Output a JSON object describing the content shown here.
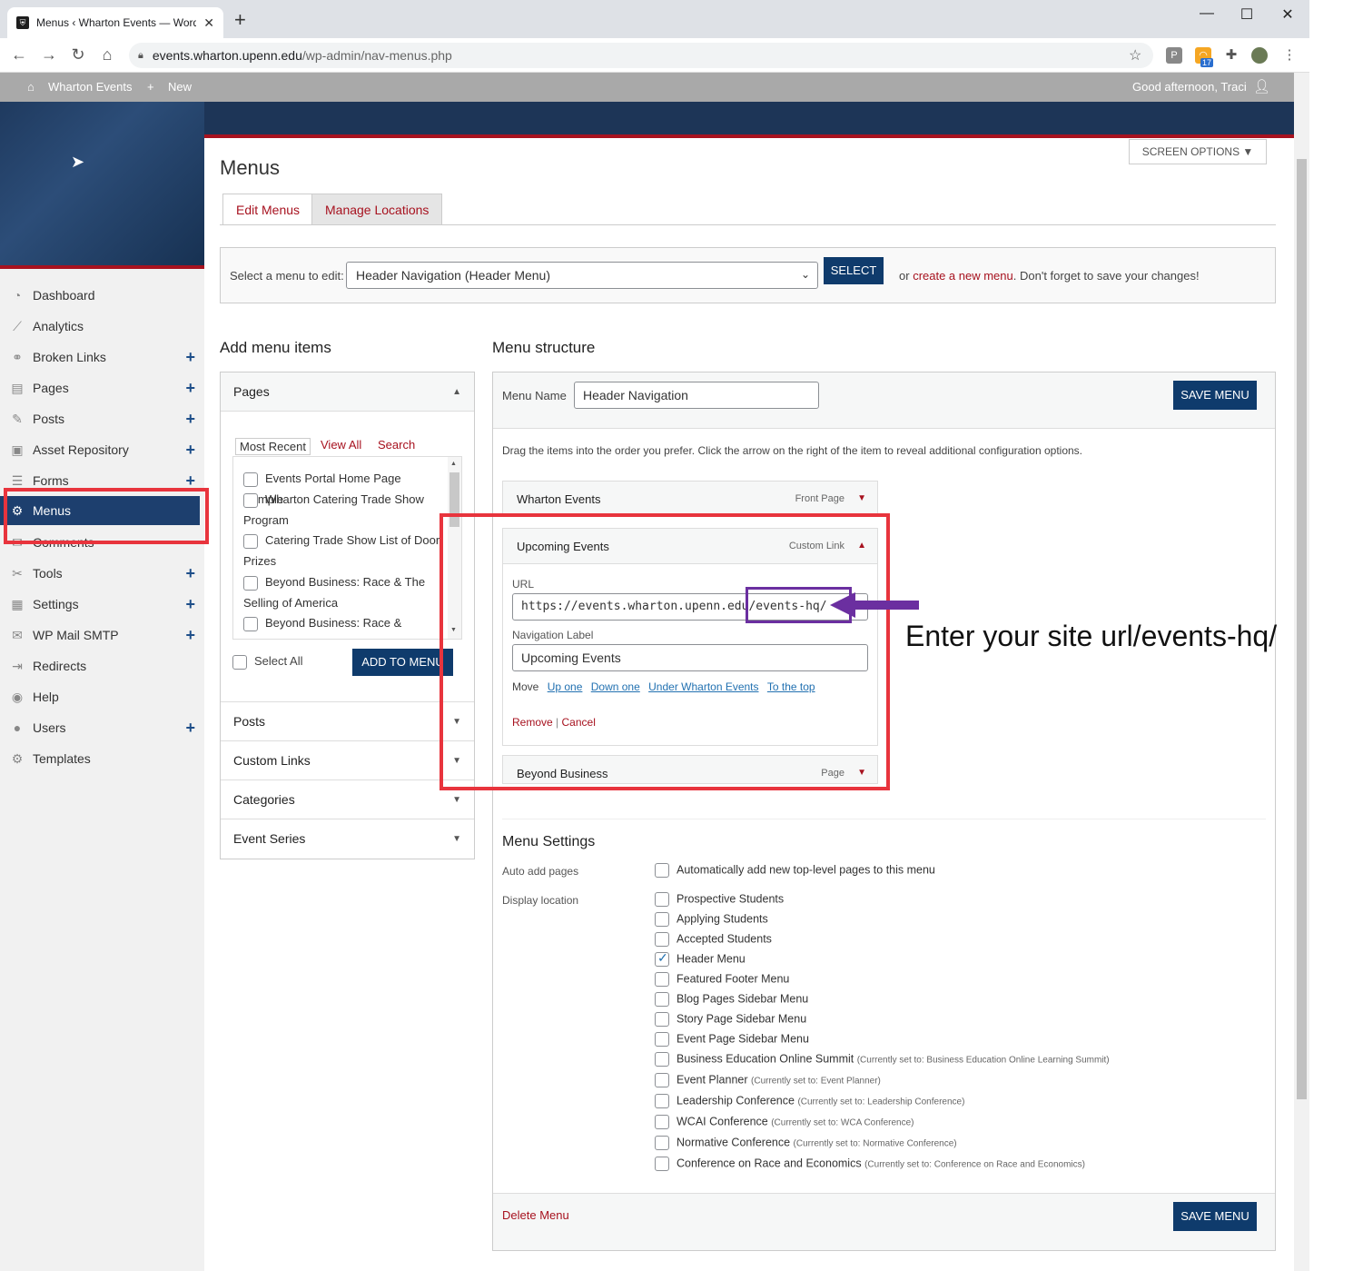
{
  "browser": {
    "tab_title": "Menus ‹ Wharton Events — Word",
    "url_host": "events.wharton.upenn.edu",
    "url_path": "/wp-admin/nav-menus.php",
    "rss_badge": "17"
  },
  "adminbar": {
    "site": "Wharton Events",
    "new": "New",
    "greeting": "Good afternoon, Traci"
  },
  "sidebar": {
    "items": [
      {
        "label": "Dashboard",
        "icon": "dashboard-icon",
        "plus": false
      },
      {
        "label": "Analytics",
        "icon": "analytics-icon",
        "plus": false
      },
      {
        "label": "Broken Links",
        "icon": "broken-link-icon",
        "plus": true
      },
      {
        "label": "Pages",
        "icon": "pages-icon",
        "plus": true
      },
      {
        "label": "Posts",
        "icon": "pin-icon",
        "plus": true
      },
      {
        "label": "Asset Repository",
        "icon": "asset-icon",
        "plus": true
      },
      {
        "label": "Forms",
        "icon": "forms-icon",
        "plus": true
      },
      {
        "label": "Menus",
        "icon": "gear-icon",
        "plus": false,
        "active": true
      },
      {
        "label": "Comments",
        "icon": "comments-icon",
        "plus": false
      },
      {
        "label": "Tools",
        "icon": "wrench-icon",
        "plus": true
      },
      {
        "label": "Settings",
        "icon": "settings-icon",
        "plus": true
      },
      {
        "label": "WP Mail SMTP",
        "icon": "mail-icon",
        "plus": true
      },
      {
        "label": "Redirects",
        "icon": "redirect-icon",
        "plus": false
      },
      {
        "label": "Help",
        "icon": "help-icon",
        "plus": false
      },
      {
        "label": "Users",
        "icon": "users-icon",
        "plus": true
      },
      {
        "label": "Templates",
        "icon": "templates-icon",
        "plus": false
      }
    ]
  },
  "page": {
    "title": "Menus",
    "screen_options": "SCREEN OPTIONS ▼",
    "tabs": [
      "Edit Menus",
      "Manage Locations"
    ],
    "select_label": "Select a menu to edit:",
    "select_value": "Header Navigation (Header Menu)",
    "select_button": "SELECT",
    "or_text": "or",
    "create_link": "create a new menu",
    "save_hint": ". Don't forget to save your changes!"
  },
  "add_items": {
    "heading": "Add menu items",
    "pages_title": "Pages",
    "subtabs": [
      "Most Recent",
      "View All",
      "Search"
    ],
    "pages": [
      "Events Portal Home Page Sample",
      "Wharton Catering Trade Show Program",
      "Catering Trade Show List of Door Prizes",
      "Beyond Business: Race & The Selling of America",
      "Beyond Business: Race &"
    ],
    "select_all": "Select All",
    "add_button": "ADD TO MENU",
    "sections": [
      "Posts",
      "Custom Links",
      "Categories",
      "Event Series"
    ]
  },
  "structure": {
    "heading": "Menu structure",
    "name_label": "Menu Name",
    "name_value": "Header Navigation",
    "save_button": "SAVE MENU",
    "instructions": "Drag the items into the order you prefer. Click the arrow on the right of the item to reveal additional configuration options.",
    "items": [
      {
        "title": "Wharton Events",
        "kind": "Front Page"
      },
      {
        "title": "Upcoming Events",
        "kind": "Custom Link"
      },
      {
        "title": "Beyond Business",
        "kind": "Page"
      }
    ],
    "url_label": "URL",
    "url_value": "https://events.wharton.upenn.edu/events-hq/",
    "nav_label": "Navigation Label",
    "nav_value": "Upcoming Events",
    "move_label": "Move",
    "move_links": [
      "Up one",
      "Down one",
      "Under Wharton Events",
      "To the top"
    ],
    "remove": "Remove",
    "cancel": "Cancel"
  },
  "settings": {
    "heading": "Menu Settings",
    "auto_label": "Auto add pages",
    "auto_option": "Automatically add new top-level pages to this menu",
    "display_label": "Display location",
    "locations": [
      {
        "name": "Prospective Students",
        "current": "",
        "checked": false
      },
      {
        "name": "Applying Students",
        "current": "",
        "checked": false
      },
      {
        "name": "Accepted Students",
        "current": "",
        "checked": false
      },
      {
        "name": "Header Menu",
        "current": "",
        "checked": true
      },
      {
        "name": "Featured Footer Menu",
        "current": "",
        "checked": false
      },
      {
        "name": "Blog Pages Sidebar Menu",
        "current": "",
        "checked": false
      },
      {
        "name": "Story Page Sidebar Menu",
        "current": "",
        "checked": false
      },
      {
        "name": "Event Page Sidebar Menu",
        "current": "",
        "checked": false
      },
      {
        "name": "Business Education Online Summit",
        "current": "(Currently set to: Business Education Online Learning Summit)",
        "checked": false
      },
      {
        "name": "Event Planner",
        "current": "(Currently set to: Event Planner)",
        "checked": false
      },
      {
        "name": "Leadership Conference",
        "current": "(Currently set to: Leadership Conference)",
        "checked": false
      },
      {
        "name": "WCAI Conference",
        "current": "(Currently set to: WCA Conference)",
        "checked": false
      },
      {
        "name": "Normative Conference",
        "current": "(Currently set to: Normative Conference)",
        "checked": false
      },
      {
        "name": "Conference on Race and Economics",
        "current": "(Currently set to: Conference on Race and Economics)",
        "checked": false
      }
    ],
    "delete": "Delete Menu"
  },
  "annotation": {
    "callout": "Enter your site url/events-hq/",
    "highlight_color": "#e8343d",
    "arrow_color": "#6b2fa0"
  }
}
